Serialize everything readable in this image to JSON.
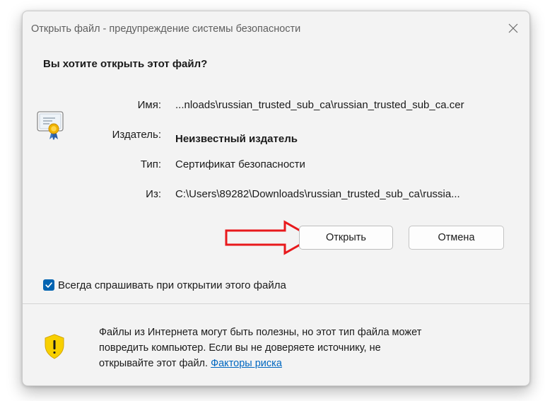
{
  "window": {
    "title": "Открыть файл - предупреждение системы безопасности"
  },
  "question": "Вы хотите открыть этот файл?",
  "details": {
    "name_label": "Имя:",
    "name_value": "...nloads\\russian_trusted_sub_ca\\russian_trusted_sub_ca.cer",
    "publisher_label": "Издатель:",
    "publisher_value": "Неизвестный издатель",
    "type_label": "Тип:",
    "type_value": "Сертификат безопасности",
    "from_label": "Из:",
    "from_value": "C:\\Users\\89282\\Downloads\\russian_trusted_sub_ca\\russia..."
  },
  "buttons": {
    "open_label": "Открыть",
    "cancel_label": "Отмена"
  },
  "checkbox": {
    "label": "Всегда спрашивать при открытии этого файла",
    "checked": true
  },
  "warning": {
    "line1": "Файлы из Интернета могут быть полезны, но этот тип файла может",
    "line2": "повредить компьютер. Если вы не доверяете источнику, не",
    "line3": "открывайте этот файл.",
    "link_label": "Факторы риска"
  },
  "icons": {
    "close": "close-icon",
    "certificate": "certificate-icon",
    "arrow": "red-arrow-icon",
    "check": "checkmark-icon",
    "shield": "shield-warning-icon"
  },
  "colors": {
    "accent": "#0063b1",
    "link": "#0067c0",
    "arrow": "#e8191c",
    "shield": "#f8d000"
  }
}
